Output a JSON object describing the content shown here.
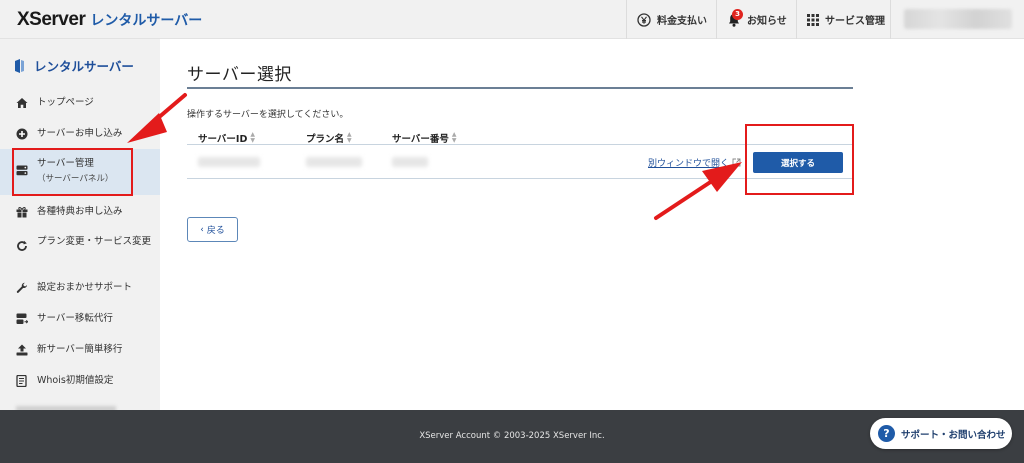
{
  "header": {
    "logo_main": "XServer",
    "logo_sub": "レンタルサーバー",
    "payment_label": "料金支払い",
    "notifications_label": "お知らせ",
    "notifications_count": "3",
    "services_label": "サービス管理"
  },
  "sidebar": {
    "title": "レンタルサーバー",
    "items": [
      {
        "label": "トップページ",
        "icon": "home-icon"
      },
      {
        "label": "サーバーお申し込み",
        "icon": "plus-circle-icon"
      },
      {
        "label": "サーバー管理",
        "sub": "（サーバーパネル）",
        "icon": "server-icon"
      },
      {
        "label": "各種特典お申し込み",
        "icon": "gift-icon"
      },
      {
        "label": "プラン変更・サービス変更",
        "icon": "refresh-icon"
      },
      {
        "label": "設定おまかせサポート",
        "icon": "wrench-icon"
      },
      {
        "label": "サーバー移転代行",
        "icon": "server-move-icon"
      },
      {
        "label": "新サーバー簡単移行",
        "icon": "upload-icon"
      },
      {
        "label": "Whois初期値設定",
        "icon": "document-icon"
      }
    ]
  },
  "main": {
    "title": "サーバー選択",
    "instruction": "操作するサーバーを選択してください。",
    "columns": [
      "サーバーID",
      "プラン名",
      "サーバー番号"
    ],
    "open_window_link": "別ウィンドウで開く",
    "select_button": "選択する",
    "back_button": "戻る"
  },
  "footer": {
    "copyright": "XServer Account © 2003-2025 XServer Inc.",
    "support_label": "サポート・お問い合わせ"
  },
  "colors": {
    "brand_blue": "#1f5ba8",
    "annotation_red": "#e31b1b",
    "footer_bg": "#3b3e42",
    "sidebar_bg": "#f1f1f1"
  }
}
